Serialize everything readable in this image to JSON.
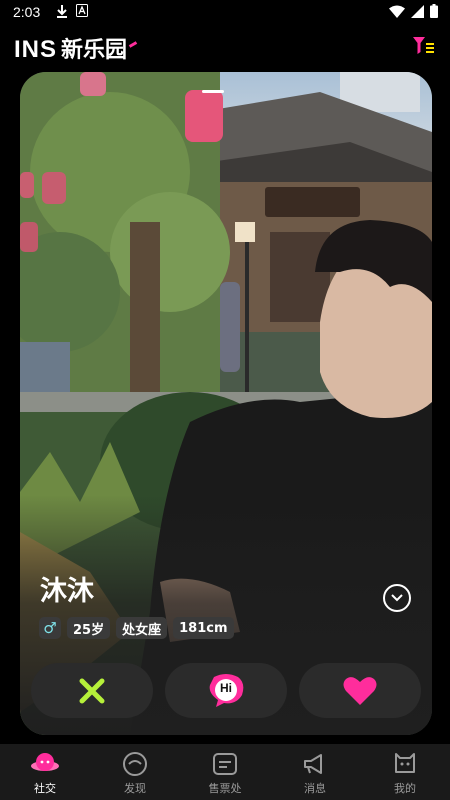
{
  "status_bar": {
    "time": "2:03",
    "icons": [
      "download-icon",
      "a-icon"
    ],
    "right_icons": [
      "wifi-icon",
      "signal-icon",
      "battery-icon"
    ]
  },
  "header": {
    "logo_latin": "INS",
    "logo_cn": "新乐园",
    "filter_icon": "filter-icon"
  },
  "colors": {
    "accent_pink": "#ff2d9c",
    "reject_green": "#b6f03a",
    "gender_cyan": "#7fe1e8",
    "background": "#000000"
  },
  "profile": {
    "name": "沐沐",
    "gender_symbol": "♂",
    "tags": [
      "25岁",
      "处女座",
      "181cm"
    ]
  },
  "actions": {
    "hi_label": "Hi",
    "reject_icon": "x-icon",
    "like_icon": "heart-icon"
  },
  "tabs": [
    {
      "label": "社交",
      "icon": "planet-icon",
      "active": true
    },
    {
      "label": "发现",
      "icon": "compass-icon",
      "active": false
    },
    {
      "label": "售票处",
      "icon": "ticket-icon",
      "active": false
    },
    {
      "label": "消息",
      "icon": "megaphone-icon",
      "active": false
    },
    {
      "label": "我的",
      "icon": "profile-icon",
      "active": false
    }
  ]
}
